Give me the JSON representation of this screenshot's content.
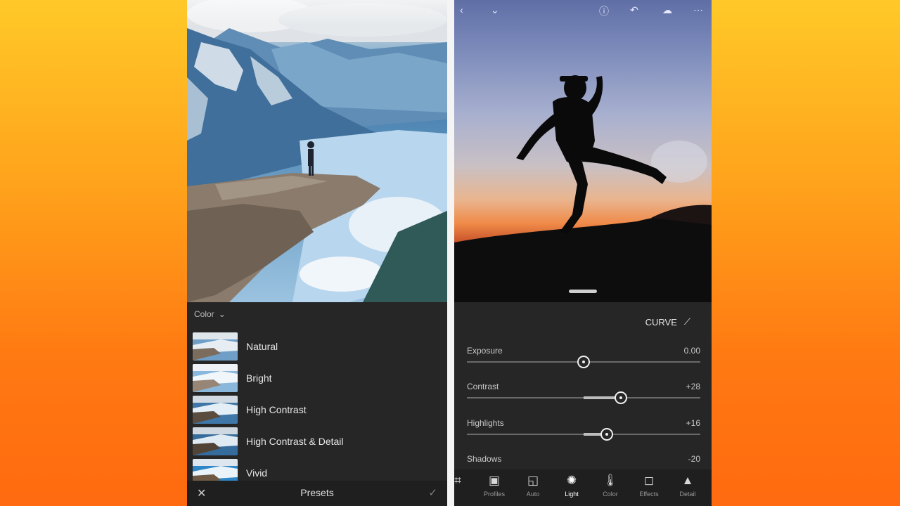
{
  "left_phone": {
    "preset_group": "Color",
    "presets": [
      {
        "label": "Natural"
      },
      {
        "label": "Bright"
      },
      {
        "label": "High Contrast"
      },
      {
        "label": "High Contrast & Detail"
      },
      {
        "label": "Vivid"
      }
    ],
    "footer_title": "Presets"
  },
  "right_phone": {
    "curve_label": "CURVE",
    "sliders": [
      {
        "label": "Exposure",
        "value": "0.00",
        "level": 0.5
      },
      {
        "label": "Contrast",
        "value": "+28",
        "level": 0.66
      },
      {
        "label": "Highlights",
        "value": "+16",
        "level": 0.6
      },
      {
        "label": "Shadows",
        "value": "-20"
      }
    ],
    "tools": [
      {
        "label": "Profiles",
        "icon": "profiles-icon"
      },
      {
        "label": "Auto",
        "icon": "auto-icon"
      },
      {
        "label": "Light",
        "icon": "light-icon",
        "active": true
      },
      {
        "label": "Color",
        "icon": "color-icon"
      },
      {
        "label": "Effects",
        "icon": "effects-icon"
      },
      {
        "label": "Detail",
        "icon": "detail-icon"
      }
    ]
  },
  "colors": {
    "background_top": "#ffc928",
    "background_bottom": "#ff6a10",
    "panel": "#262626"
  }
}
